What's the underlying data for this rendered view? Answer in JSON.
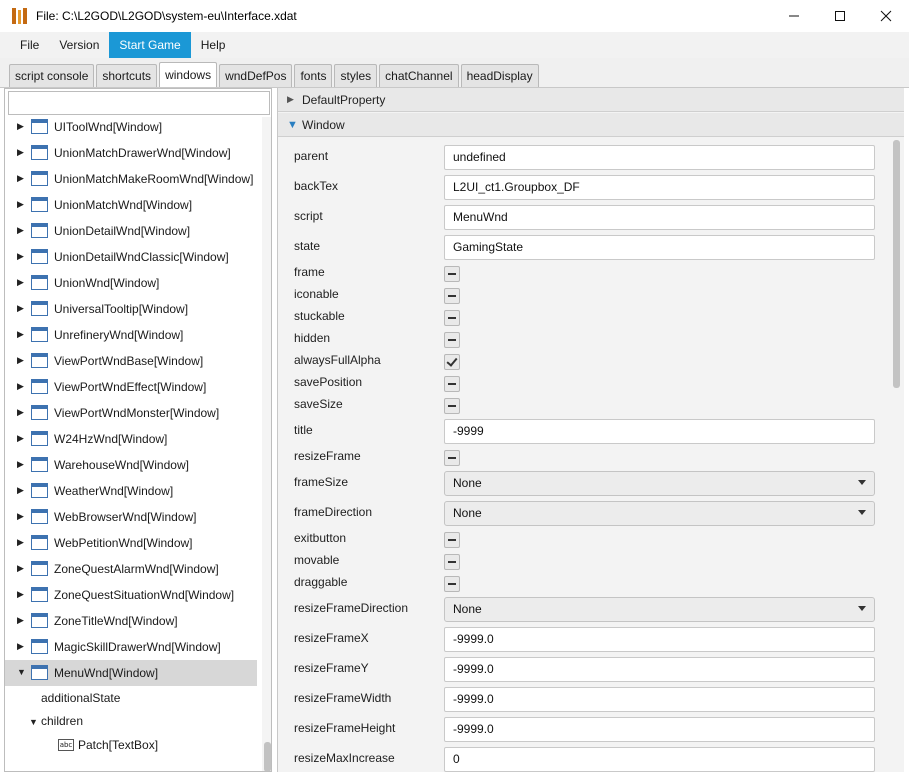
{
  "window": {
    "title": "File: C:\\L2GOD\\L2GOD\\system-eu\\Interface.xdat",
    "minimize_icon": "minimize-glyph",
    "maximize_icon": "maximize-glyph",
    "close_icon": "close-glyph"
  },
  "menu": [
    "File",
    "Version",
    "Start Game",
    "Help"
  ],
  "menu_active": "Start Game",
  "accent_color": "#1b98d6",
  "tabs": [
    "script console",
    "shortcuts",
    "windows",
    "wndDefPos",
    "fonts",
    "styles",
    "chatChannel",
    "headDisplay"
  ],
  "active_tab": "windows",
  "tree": {
    "search_value": "",
    "items": [
      "UIToolWnd[Window]",
      "UnionMatchDrawerWnd[Window]",
      "UnionMatchMakeRoomWnd[Window]",
      "UnionMatchWnd[Window]",
      "UnionDetailWnd[Window]",
      "UnionDetailWndClassic[Window]",
      "UnionWnd[Window]",
      "UniversalTooltip[Window]",
      "UnrefineryWnd[Window]",
      "ViewPortWndBase[Window]",
      "ViewPortWndEffect[Window]",
      "ViewPortWndMonster[Window]",
      "W24HzWnd[Window]",
      "WarehouseWnd[Window]",
      "WeatherWnd[Window]",
      "WebBrowserWnd[Window]",
      "WebPetitionWnd[Window]",
      "ZoneQuestAlarmWnd[Window]",
      "ZoneQuestSituationWnd[Window]",
      "ZoneTitleWnd[Window]",
      "MagicSkillDrawerWnd[Window]",
      "MenuWnd[Window]"
    ],
    "selected": "MenuWnd[Window]",
    "children": {
      "additional_state": "additionalState",
      "children_label": "children",
      "textbox_item": "Patch[TextBox]",
      "textbox_icon_text": "abc"
    }
  },
  "sections": {
    "default_property": "DefaultProperty",
    "window": "Window"
  },
  "properties": [
    {
      "label": "parent",
      "kind": "text",
      "value": "undefined"
    },
    {
      "label": "backTex",
      "kind": "text",
      "value": "L2UI_ct1.Groupbox_DF"
    },
    {
      "label": "script",
      "kind": "text",
      "value": "MenuWnd"
    },
    {
      "label": "state",
      "kind": "text",
      "value": "GamingState"
    },
    {
      "label": "frame",
      "kind": "check",
      "value": "indeterminate"
    },
    {
      "label": "iconable",
      "kind": "check",
      "value": "indeterminate"
    },
    {
      "label": "stuckable",
      "kind": "check",
      "value": "indeterminate"
    },
    {
      "label": "hidden",
      "kind": "check",
      "value": "indeterminate"
    },
    {
      "label": "alwaysFullAlpha",
      "kind": "check",
      "value": "checked"
    },
    {
      "label": "savePosition",
      "kind": "check",
      "value": "indeterminate"
    },
    {
      "label": "saveSize",
      "kind": "check",
      "value": "indeterminate"
    },
    {
      "label": "title",
      "kind": "text",
      "value": "-9999"
    },
    {
      "label": "resizeFrame",
      "kind": "check",
      "value": "indeterminate"
    },
    {
      "label": "frameSize",
      "kind": "select",
      "value": "None"
    },
    {
      "label": "frameDirection",
      "kind": "select",
      "value": "None"
    },
    {
      "label": "exitbutton",
      "kind": "check",
      "value": "indeterminate"
    },
    {
      "label": "movable",
      "kind": "check",
      "value": "indeterminate"
    },
    {
      "label": "draggable",
      "kind": "check",
      "value": "indeterminate"
    },
    {
      "label": "resizeFrameDirection",
      "kind": "select",
      "value": "None"
    },
    {
      "label": "resizeFrameX",
      "kind": "text",
      "value": "-9999.0"
    },
    {
      "label": "resizeFrameY",
      "kind": "text",
      "value": "-9999.0"
    },
    {
      "label": "resizeFrameWidth",
      "kind": "text",
      "value": "-9999.0"
    },
    {
      "label": "resizeFrameHeight",
      "kind": "text",
      "value": "-9999.0"
    },
    {
      "label": "resizeMaxIncrease",
      "kind": "text",
      "value": "0"
    }
  ]
}
